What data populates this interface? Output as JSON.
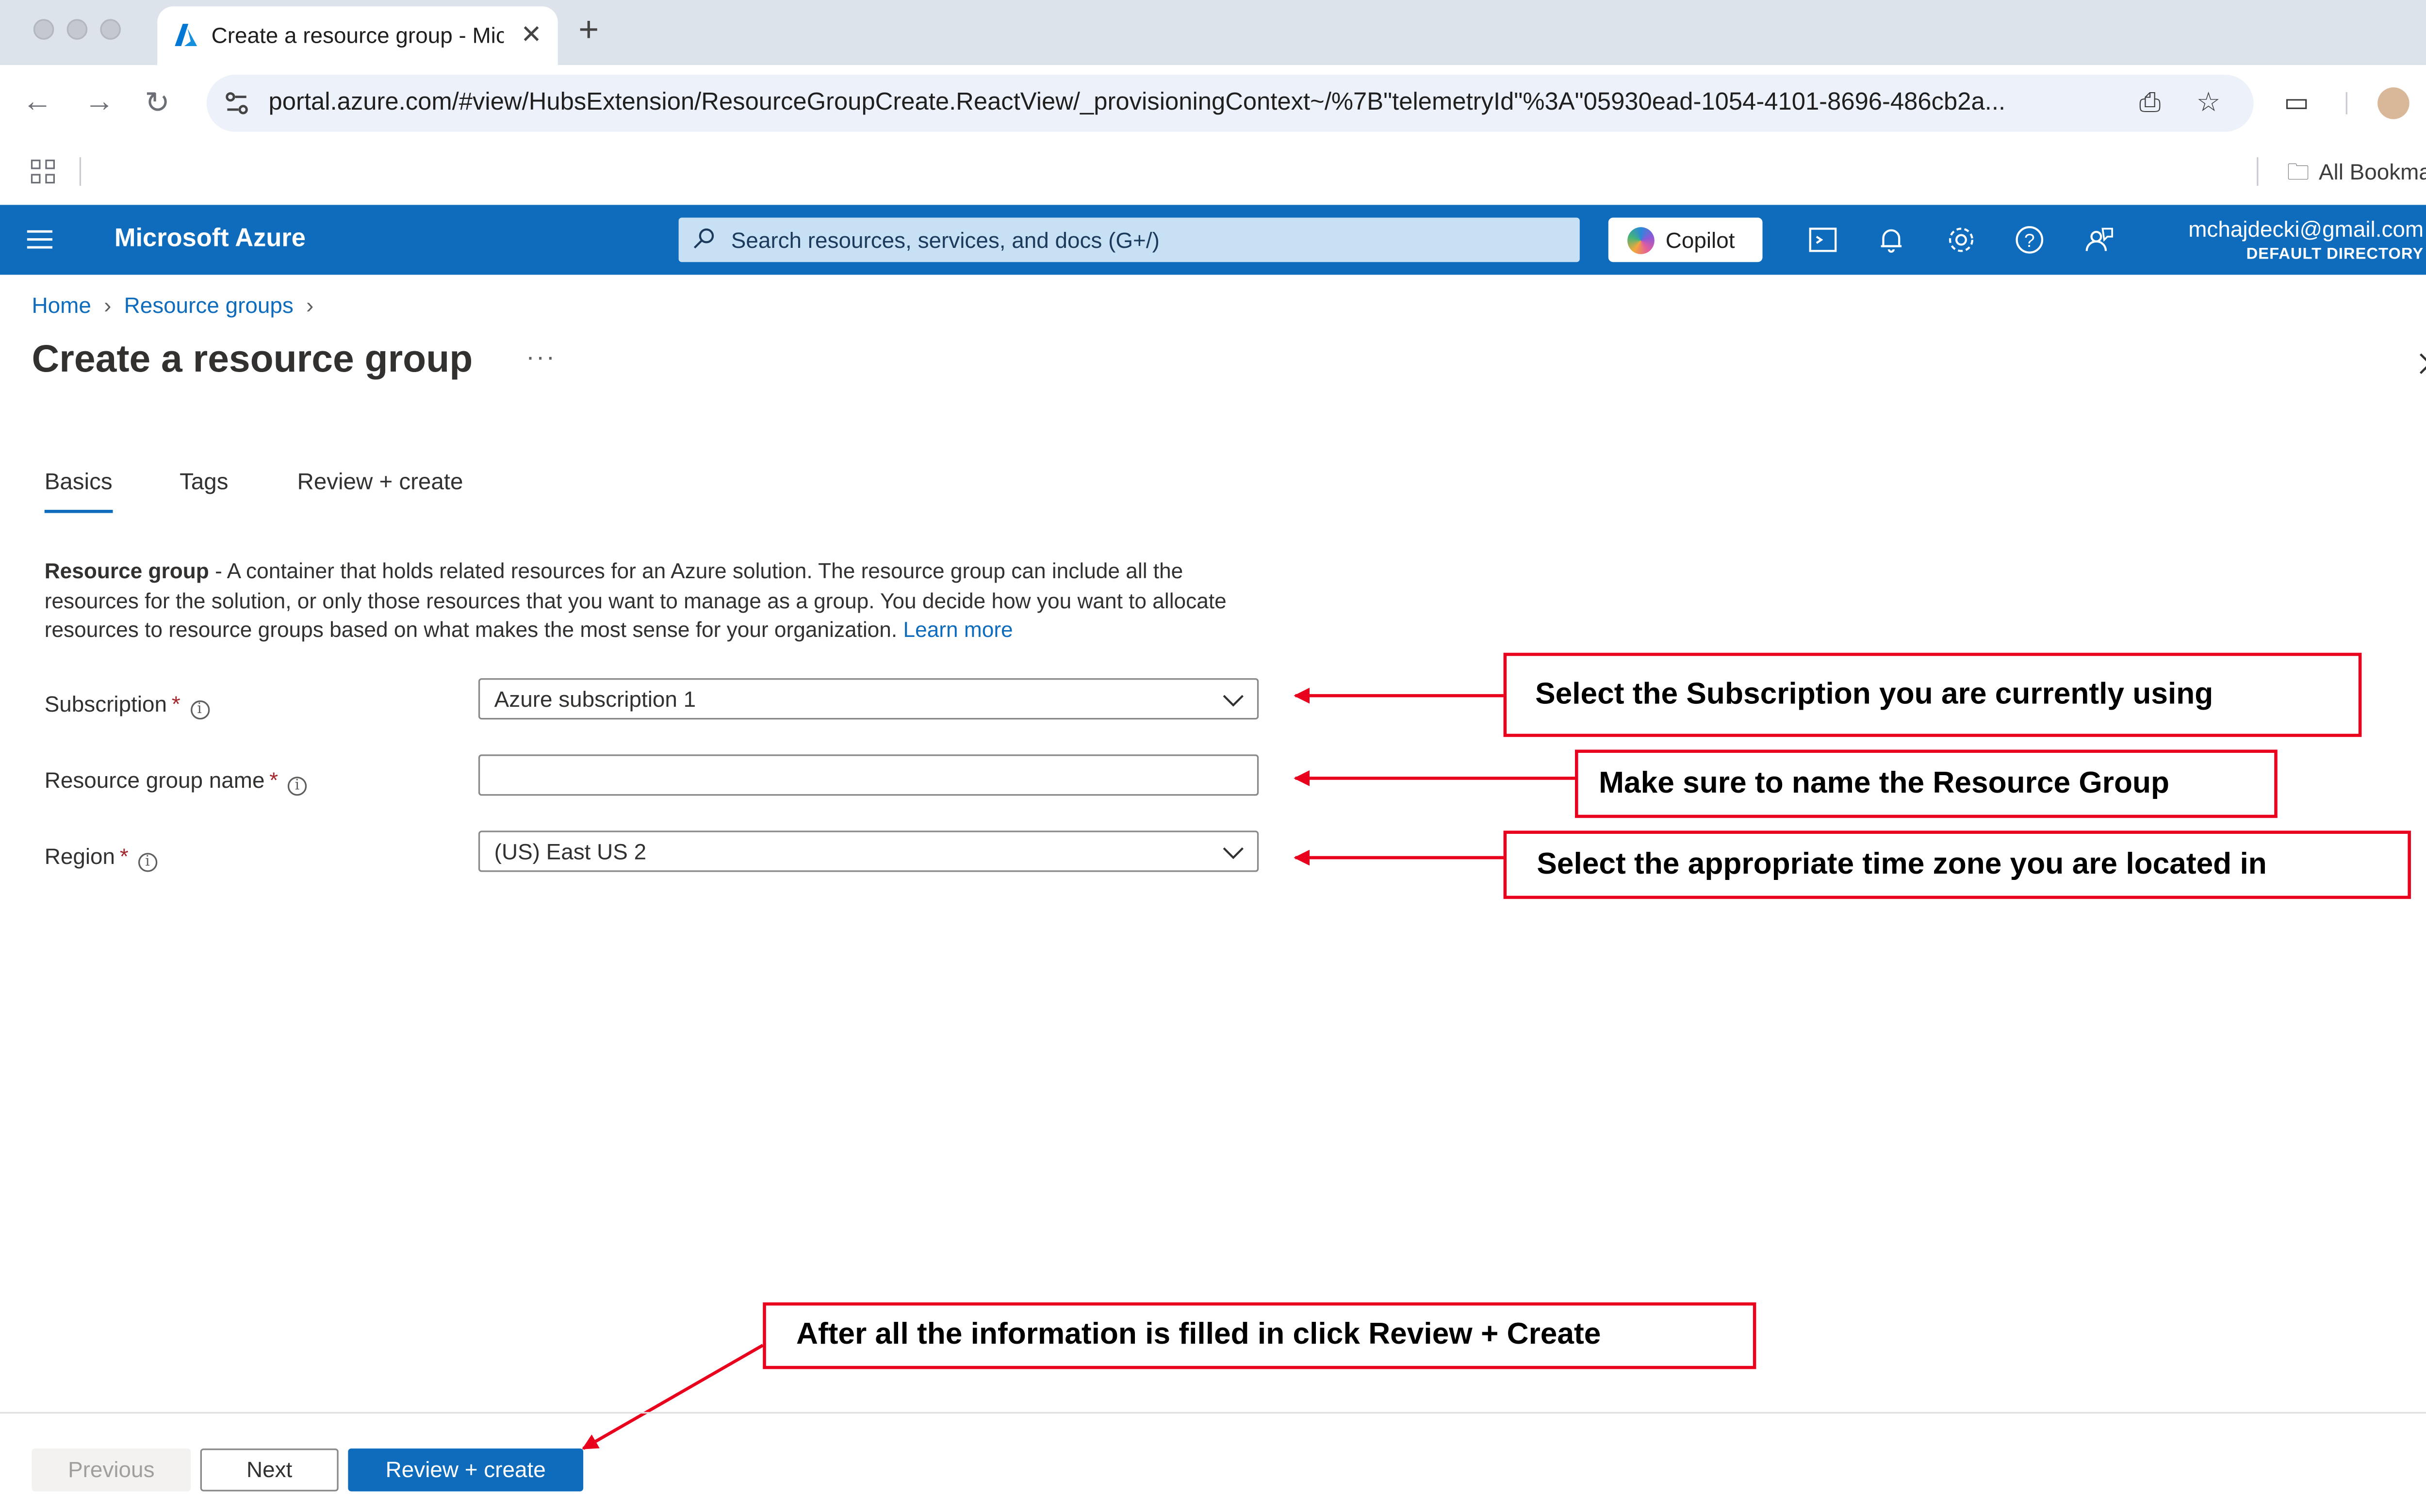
{
  "browser": {
    "tab_title": "Create a resource group - Mic",
    "url": "portal.azure.com/#view/HubsExtension/ResourceGroupCreate.ReactView/_provisioningContext~/%7B\"telemetryId\"%3A\"05930ead-1054-4101-8696-486cb2a...",
    "bookmarks_all": "All Bookmarks"
  },
  "azure_header": {
    "brand": "Microsoft Azure",
    "search_placeholder": "Search resources, services, and docs (G+/)",
    "copilot_label": "Copilot",
    "account_email": "mchajdecki@gmail.com",
    "account_directory": "DEFAULT DIRECTORY",
    "accent_color": "#0f6cbd"
  },
  "breadcrumb": [
    "Home",
    "Resource groups"
  ],
  "page": {
    "title": "Create a resource group",
    "more": "···"
  },
  "tabs": [
    "Basics",
    "Tags",
    "Review + create"
  ],
  "active_tab": "Basics",
  "description": {
    "bold": "Resource group",
    "text": " - A container that holds related resources for an Azure solution. The resource group can include all the resources for the solution, or only those resources that you want to manage as a group. You decide how you want to allocate resources to resource groups based on what makes the most sense for your organization.",
    "link": "Learn more"
  },
  "form": {
    "subscription": {
      "label": "Subscription",
      "required": "*",
      "value": "Azure subscription 1"
    },
    "resource_group_name": {
      "label": "Resource group name",
      "required": "*",
      "value": ""
    },
    "region": {
      "label": "Region",
      "required": "*",
      "value": "(US) East US 2"
    }
  },
  "annotations": {
    "subscription": "Select the Subscription you are currently using",
    "name": "Make sure to name the Resource Group",
    "region": "Select the appropriate time zone you are located in",
    "review": "After all the information is filled in click Review + Create",
    "color": "#e8001c"
  },
  "footer": {
    "previous": "Previous",
    "next": "Next",
    "review_create": "Review + create"
  }
}
